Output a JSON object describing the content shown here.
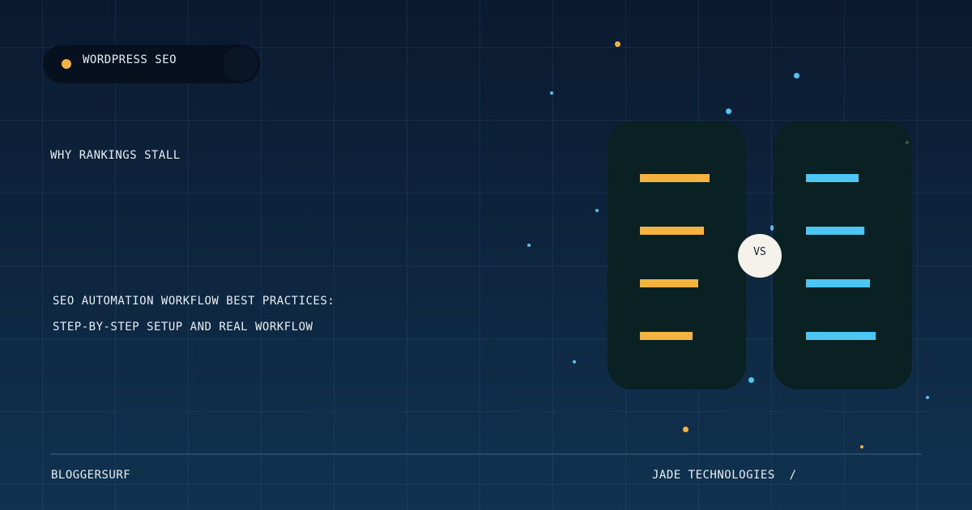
{
  "badge": {
    "label": "WORDPRESS SEO"
  },
  "kicker": "WHY RANKINGS STALL",
  "title": {
    "line1": "SEO AUTOMATION WORKFLOW BEST PRACTICES:",
    "line2": "STEP-BY-STEP SETUP AND REAL WORKFLOW"
  },
  "footer": {
    "brand": "BLOGGERSURF",
    "publisher": "JADE TECHNOLOGIES  /"
  },
  "compare": {
    "vs_label": "VS",
    "left_color": "#f6b23f",
    "right_color": "#4cc7f4"
  },
  "colors": {
    "accent_orange": "#f6b23f",
    "accent_blue": "#4cc7f4",
    "panel": "#0a2123"
  }
}
